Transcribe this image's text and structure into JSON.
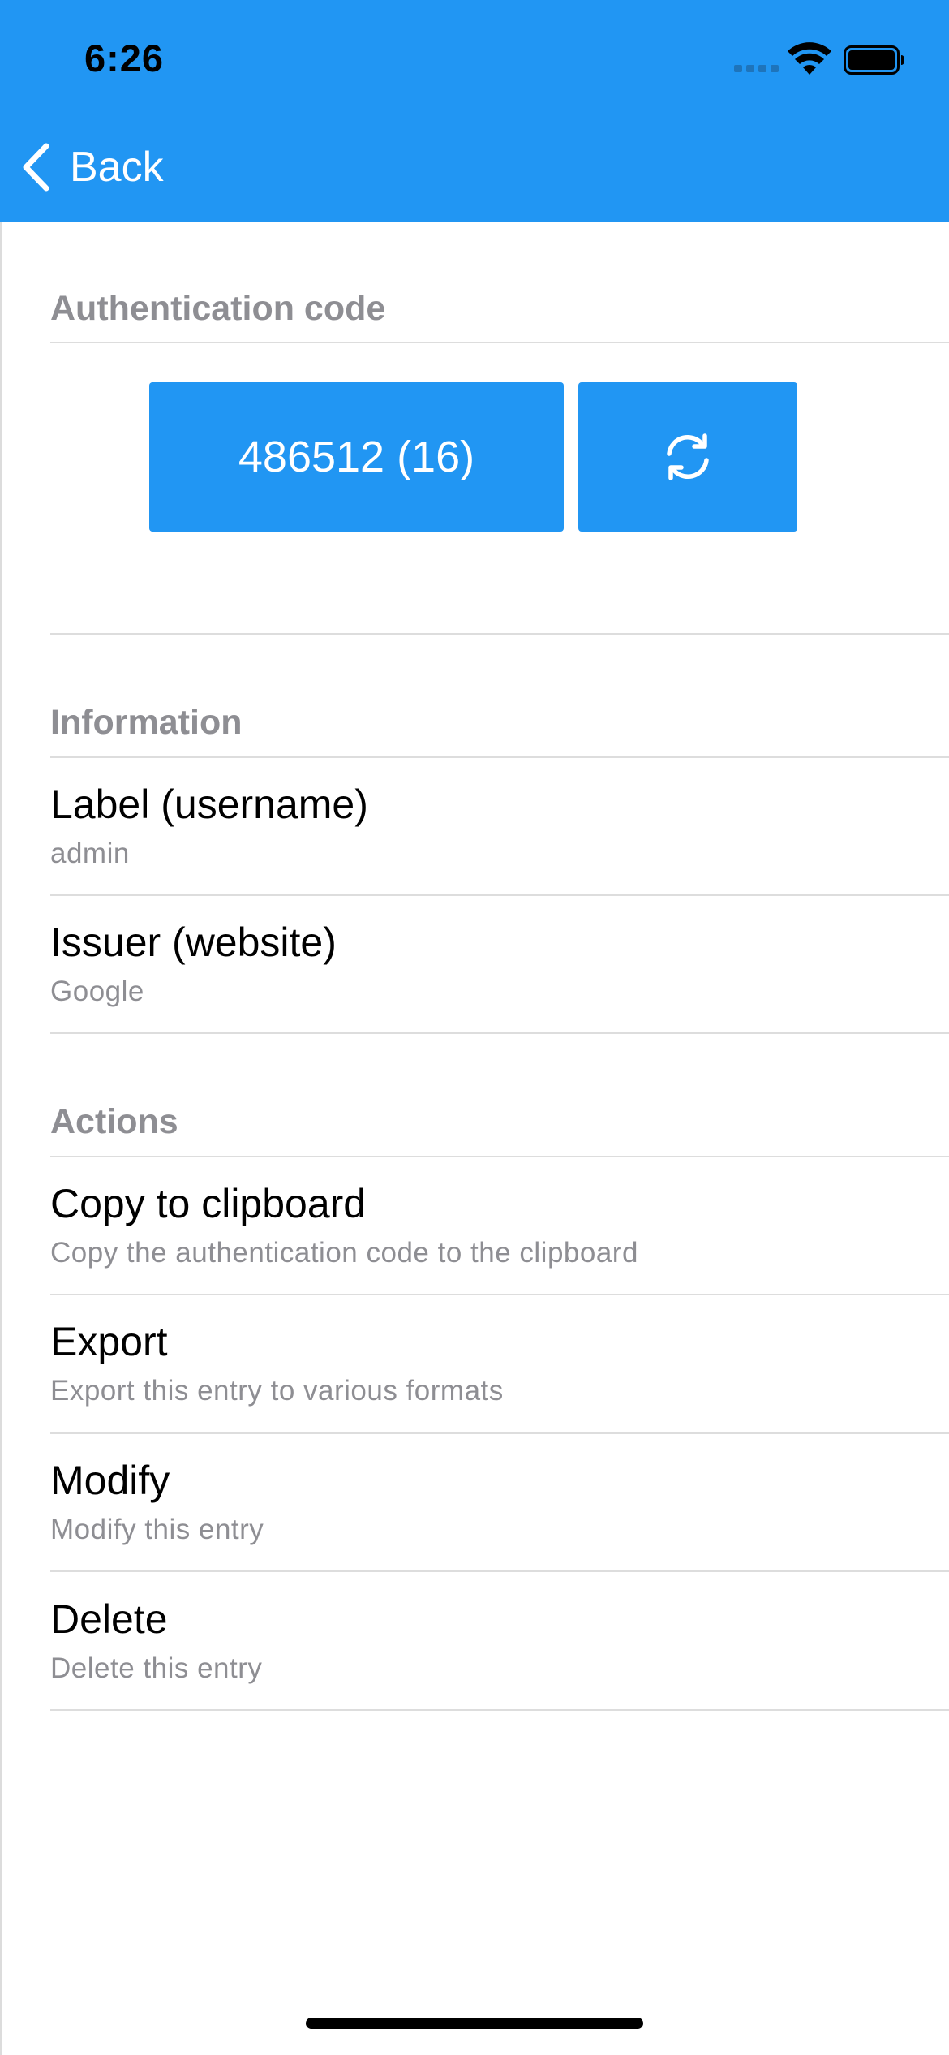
{
  "status_bar": {
    "time": "6:26",
    "icons": [
      "signal-icon",
      "wifi-icon",
      "battery-icon"
    ]
  },
  "nav": {
    "back_label": "Back",
    "back_icon": "chevron-left-icon"
  },
  "colors": {
    "accent": "#2196F3",
    "section_title": "#8e8e93",
    "divider": "#dddddd"
  },
  "auth": {
    "section_title": "Authentication code",
    "code_label": "486512 (16)",
    "refresh_icon": "refresh-icon"
  },
  "information": {
    "section_title": "Information",
    "items": [
      {
        "title": "Label (username)",
        "subtitle": "admin"
      },
      {
        "title": "Issuer (website)",
        "subtitle": "Google"
      }
    ]
  },
  "actions": {
    "section_title": "Actions",
    "items": [
      {
        "title": "Copy to clipboard",
        "subtitle": "Copy the authentication code to the clipboard"
      },
      {
        "title": "Export",
        "subtitle": "Export this entry to various formats"
      },
      {
        "title": "Modify",
        "subtitle": "Modify this entry"
      },
      {
        "title": "Delete",
        "subtitle": "Delete this entry"
      }
    ]
  }
}
